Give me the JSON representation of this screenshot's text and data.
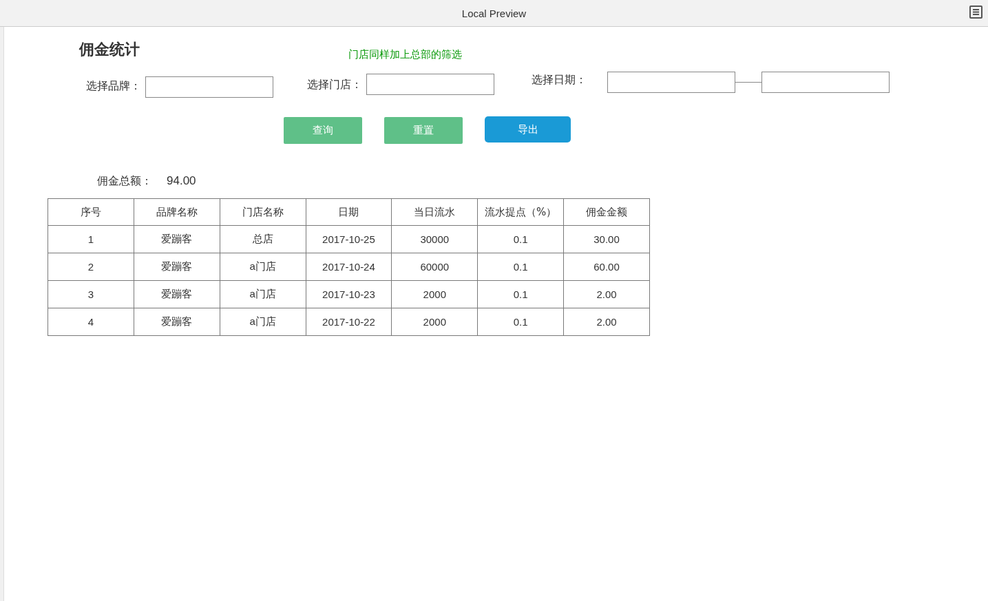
{
  "window": {
    "title": "Local Preview"
  },
  "page": {
    "title": "佣金统计",
    "note": "门店同样加上总部的筛选"
  },
  "filters": {
    "brand_label": "选择品牌：",
    "store_label": "选择门店：",
    "date_label": "选择日期："
  },
  "buttons": [
    {
      "label": "查询",
      "kind": "green"
    },
    {
      "label": "重置",
      "kind": "green"
    },
    {
      "label": "导出",
      "kind": "blue"
    }
  ],
  "total": {
    "label": "佣金总额：",
    "value": "94.00"
  },
  "table": {
    "columns": [
      "序号",
      "品牌名称",
      "门店名称",
      "日期",
      "当日流水",
      "流水提点（%）",
      "佣金金额"
    ],
    "rows": [
      [
        "1",
        "爱蹦客",
        "总店",
        "2017-10-25",
        "30000",
        "0.1",
        "30.00"
      ],
      [
        "2",
        "爱蹦客",
        "a门店",
        "2017-10-24",
        "60000",
        "0.1",
        "60.00"
      ],
      [
        "3",
        "爱蹦客",
        "a门店",
        "2017-10-23",
        "2000",
        "0.1",
        "2.00"
      ],
      [
        "4",
        "爱蹦客",
        "a门店",
        "2017-10-22",
        "2000",
        "0.1",
        "2.00"
      ]
    ]
  }
}
